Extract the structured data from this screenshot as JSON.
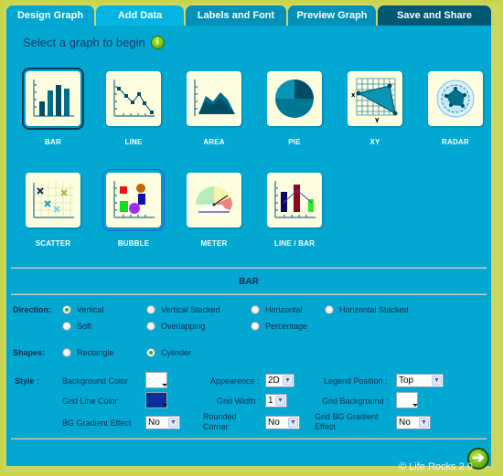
{
  "tabs": [
    {
      "label": "Design Graph",
      "active": true
    },
    {
      "label": "Add Data"
    },
    {
      "label": "Labels and Font"
    },
    {
      "label": "Preview Graph"
    },
    {
      "label": "Save and Share"
    }
  ],
  "title": "Select a graph to begin",
  "info_icon": "i",
  "graph_types": [
    {
      "label": "BAR",
      "icon": "bar-chart-icon",
      "selected": true
    },
    {
      "label": "LINE",
      "icon": "line-chart-icon"
    },
    {
      "label": "AREA",
      "icon": "area-chart-icon"
    },
    {
      "label": "PIE",
      "icon": "pie-chart-icon"
    },
    {
      "label": "XY",
      "icon": "xy-chart-icon",
      "axis_x": "x",
      "axis_y": "y"
    },
    {
      "label": "RADAR",
      "icon": "radar-chart-icon"
    },
    {
      "label": "SCATTER",
      "icon": "scatter-chart-icon"
    },
    {
      "label": "BUBBLE",
      "icon": "bubble-chart-icon",
      "hovered": true
    },
    {
      "label": "METER",
      "icon": "meter-chart-icon"
    },
    {
      "label": "LINE / BAR",
      "icon": "line-bar-chart-icon"
    }
  ],
  "section_title": "BAR",
  "direction": {
    "label": "Direction:",
    "options": [
      "Vertical",
      "Vertical Stacked",
      "Horizontal",
      "Horizontal Stacked",
      "Soft",
      "Overlapping",
      "Percentage"
    ],
    "selected": "Vertical"
  },
  "shapes": {
    "label": "Shapes:",
    "options": [
      "Rectangle",
      "Cylinder"
    ],
    "selected": "Cylinder"
  },
  "style": {
    "label": "Style :",
    "background_color": {
      "label": "Background Color",
      "value": "#ffffff"
    },
    "grid_line_color": {
      "label": "Grid Line Color",
      "value": "#0a2f99"
    },
    "bg_gradient_effect": {
      "label": "BG Gradient Effect",
      "value": "No"
    },
    "appearence": {
      "label": "Appearence :",
      "value": "2D"
    },
    "grid_width": {
      "label": "Grid Width :",
      "value": "1"
    },
    "rounded_corner": {
      "label_line1": "Rounded",
      "label_line2": "Corner",
      "value": "No"
    },
    "legend_position": {
      "label": "Legend Position :",
      "value": "Top"
    },
    "grid_background": {
      "label": "Grid Background :",
      "value": "#ffffff"
    },
    "grid_bg_gradient_effect": {
      "label_line1": "Grid BG Gradient",
      "label_line2": "Effect",
      "value": "No"
    },
    "colon": ":"
  },
  "footer": {
    "next_icon": "➔",
    "copyright": "© Life Rocks 2.0"
  },
  "colors": {
    "panel": "#03a8d2",
    "frame": "#cbd660",
    "active_tab": "#02a6d1",
    "dark_tab": "#005872"
  }
}
